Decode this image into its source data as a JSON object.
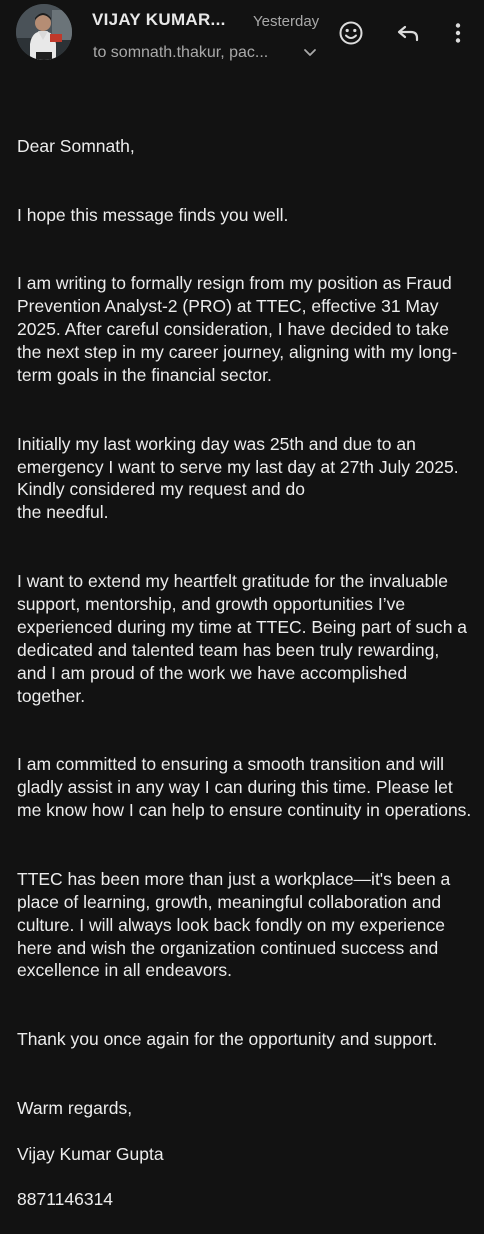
{
  "header": {
    "sender_name": "VIJAY KUMAR...",
    "timestamp": "Yesterday",
    "recipients": "to somnath.thakur, pac...",
    "icons": {
      "avatar": "avatar",
      "recipients_toggle": "chevron-down-icon",
      "emoji_reaction": "emoji-smile-icon",
      "reply": "reply-icon",
      "more": "more-vert-icon"
    }
  },
  "email": {
    "greeting": "Dear Somnath,",
    "paragraphs": [
      "I hope this message finds you well.",
      "I am writing to formally resign from my position as Fraud Prevention Analyst-2 (PRO) at TTEC, effective 31 May 2025. After careful consideration, I have decided to take the next step in my career journey, aligning with my long-term goals in the financial sector.",
      "Initially my last working day was 25th and due to an emergency I want to serve my last day at 27th July 2025. Kindly considered my request and do\nthe needful.",
      "I want to extend my heartfelt gratitude for the invaluable support, mentorship, and growth opportunities I’ve experienced during my time at TTEC. Being part of such a dedicated and talented team has been truly rewarding, and I am proud of the work we have accomplished together.",
      "I am committed to ensuring a smooth transition and will gladly assist in any way I can during this time. Please let me know how I can help to ensure continuity in operations.",
      "TTEC has been more than just a workplace—it's been a place of learning, growth,  meaningful collaboration and culture. I will always look back fondly on my experience here and wish the organization continued success and excellence in all endeavors.",
      "Thank you once again for the opportunity and support."
    ],
    "closing": "Warm regards,",
    "signature_name": "Vijay Kumar Gupta",
    "signature_phone": "8871146314"
  },
  "colors": {
    "background": "#121212",
    "text_primary": "#ececec",
    "text_secondary": "#a9a9a9"
  }
}
